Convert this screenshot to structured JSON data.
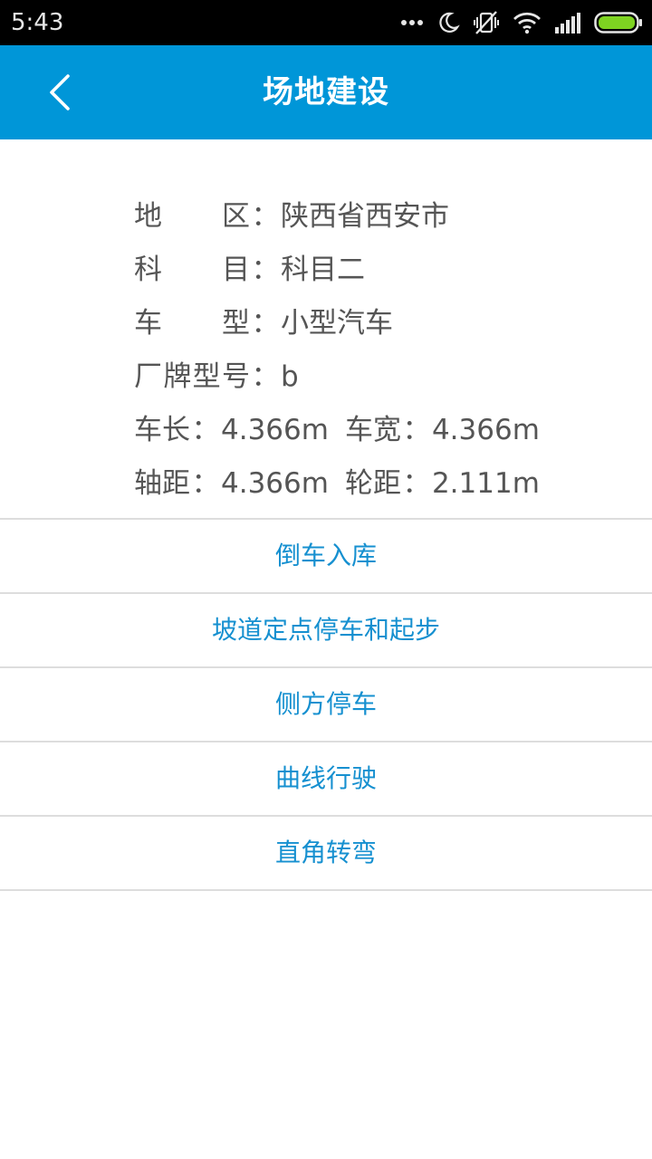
{
  "status_bar": {
    "time": "5:43",
    "icons": [
      "more-dots-icon",
      "moon-icon",
      "vibrate-off-icon",
      "wifi-icon",
      "signal-icon",
      "battery-icon"
    ],
    "battery_color": "#7ed321"
  },
  "header": {
    "title": "场地建设",
    "back_icon": "chevron-left-icon",
    "background": "#0096d8"
  },
  "info": {
    "region": {
      "label": "地区",
      "value": "陕西省西安市"
    },
    "subject": {
      "label": "科目",
      "value": "科目二"
    },
    "vehicle_type": {
      "label": "车型",
      "value": "小型汽车"
    },
    "model": {
      "label": "厂牌型号",
      "value": "b"
    },
    "length": {
      "label": "车长",
      "value": "4.366m"
    },
    "width": {
      "label": "车宽",
      "value": "4.366m"
    },
    "wheelbase": {
      "label": "轴距",
      "value": "4.366m"
    },
    "track": {
      "label": "轮距",
      "value": "2.111m"
    },
    "separator": "："
  },
  "menu": {
    "items": [
      "倒车入库",
      "坡道定点停车和起步",
      "侧方停车",
      "曲线行驶",
      "直角转弯"
    ],
    "text_color": "#1690d0"
  }
}
